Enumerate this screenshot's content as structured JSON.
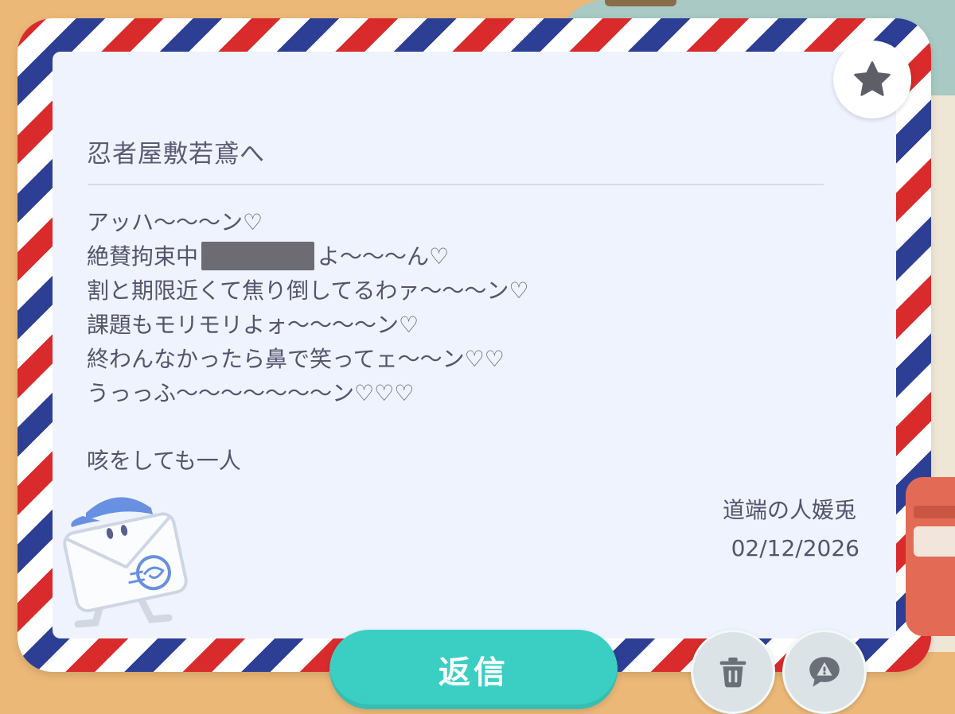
{
  "letter": {
    "title": "忍者屋敷若鳶へ",
    "lines": [
      "アッハ〜〜〜ン♡",
      "絶賛拘束中",
      "よ〜〜〜ん♡",
      "割と期限近くて焦り倒してるわァ〜〜〜ン♡",
      "課題もモリモリよォ〜〜〜〜ン♡",
      "終わんなかったら鼻で笑ってェ〜〜ン♡♡",
      "うっっふ〜〜〜〜〜〜〜ン♡♡♡"
    ],
    "closing": "咳をしても一人",
    "signature": "道端の人媛兎",
    "date": "02/12/2026"
  },
  "actions": {
    "reply_label": "返信"
  },
  "icons": {
    "favorite": "star-icon",
    "delete": "trash-icon",
    "report": "report-icon"
  },
  "colors": {
    "reply_button": "#3bcfc4",
    "paper": "#eff3fd",
    "stripe_red": "#d92b2b",
    "stripe_blue": "#2d3f94",
    "background": "#ebb877"
  }
}
